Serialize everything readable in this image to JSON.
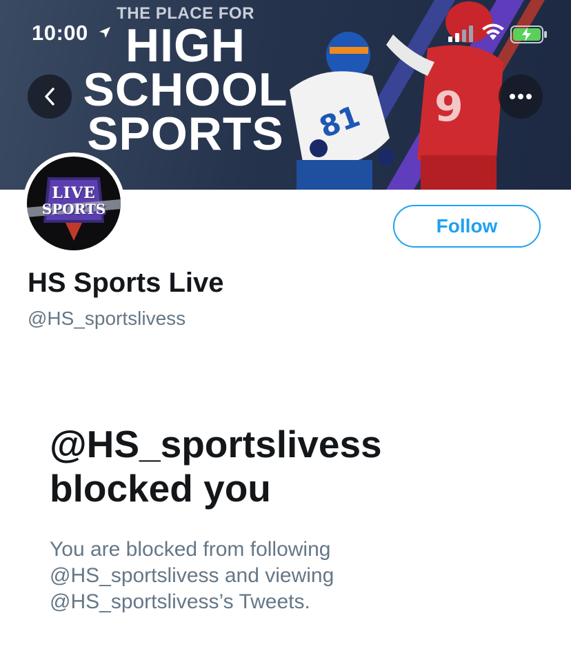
{
  "status_bar": {
    "time": "10:00",
    "icons": [
      "location-arrow-icon",
      "cellular-signal-icon",
      "wifi-icon",
      "battery-charging-icon"
    ]
  },
  "banner": {
    "tagline": "THE PLACE FOR",
    "headline_line1": "HIGH",
    "headline_line2": "SCHOOL",
    "headline_line3": "SPORTS",
    "player1_number": "81",
    "player2_number": "9"
  },
  "nav": {
    "back_icon": "chevron-left-icon",
    "more_icon": "more-horizontal-icon"
  },
  "profile": {
    "avatar_text_line1": "LIVE",
    "avatar_text_line2": "SPORTS",
    "display_name": "HS Sports Live",
    "handle": "@HS_sportslivess",
    "follow_label": "Follow"
  },
  "blocked": {
    "title_line1": "@HS_sportslivess",
    "title_line2": "blocked you",
    "description": "You are blocked from following @HS_sportslivess and viewing @HS_sportslivess’s Tweets."
  },
  "colors": {
    "accent": "#1da1f2",
    "text_primary": "#14171a",
    "text_secondary": "#657786",
    "banner_bg": "#25334d"
  }
}
